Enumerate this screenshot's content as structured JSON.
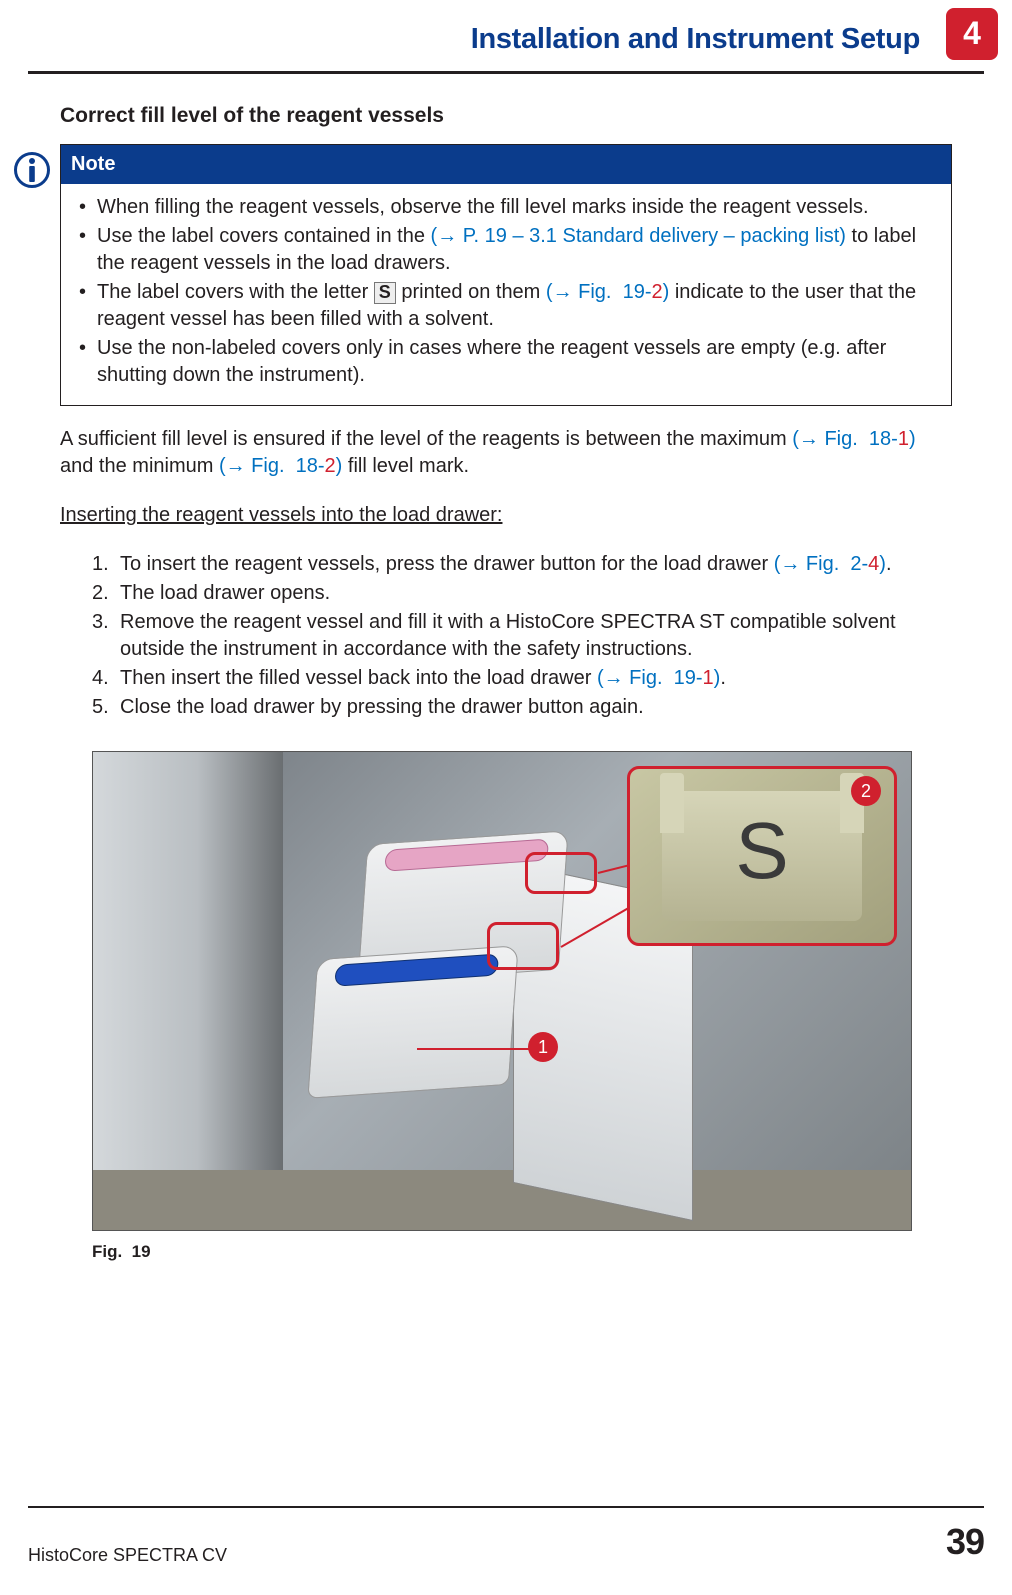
{
  "header": {
    "title": "Installation and Instrument Setup",
    "chapter": "4"
  },
  "section_title": "Correct fill level of the reagent vessels",
  "note": {
    "label": "Note",
    "items": {
      "i1": "When filling the reagent vessels, observe the fill level marks inside the reagent vessels.",
      "i2a": "Use the label covers contained in the ",
      "i2link": "(→ P. 19 – 3.1 Standard delivery – packing list)",
      "i2b": " to label the reagent vessels in the load drawers.",
      "i3a": "The label covers with the letter ",
      "i3s": "S",
      "i3b": " printed on them ",
      "i3link_a": "(→ Fig.  19-",
      "i3link_b": "2",
      "i3link_c": ")",
      "i3c": " indicate to the user that the reagent vessel has been filled with a solvent.",
      "i4": "Use the non-labeled covers only in cases where the reagent vessels are empty (e.g. after shutting down the instrument)."
    }
  },
  "para": {
    "a": "A sufficient fill level is ensured if the level of the reagents is between the maximum ",
    "ref1_a": "(→ Fig.  18-",
    "ref1_b": "1",
    "ref1_c": ")",
    "b": " and the minimum ",
    "ref2_a": "(→ Fig.  18-",
    "ref2_b": "2",
    "ref2_c": ")",
    "c": " fill level mark."
  },
  "subhead": "Inserting the reagent vessels into the load drawer:",
  "steps": {
    "s1a": "To insert the reagent vessels, press the drawer button for the load drawer ",
    "s1ref_a": "(→ Fig.  2-",
    "s1ref_b": "4",
    "s1ref_c": ")",
    "s1b": ".",
    "s2": "The load drawer opens.",
    "s3": "Remove the reagent vessel and fill it with a HistoCore SPECTRA ST compatible solvent outside the instrument in accordance with the safety instructions.",
    "s4a": "Then insert the filled vessel back into the load drawer ",
    "s4ref_a": "(→ Fig.  19-",
    "s4ref_b": "1",
    "s4ref_c": ")",
    "s4b": ".",
    "s5": "Close the load drawer by pressing the drawer button again."
  },
  "figure": {
    "caption": "Fig.  19",
    "callout1": "1",
    "callout2": "2",
    "inset_letter": "S"
  },
  "footer": {
    "product": "HistoCore SPECTRA CV",
    "page": "39"
  }
}
